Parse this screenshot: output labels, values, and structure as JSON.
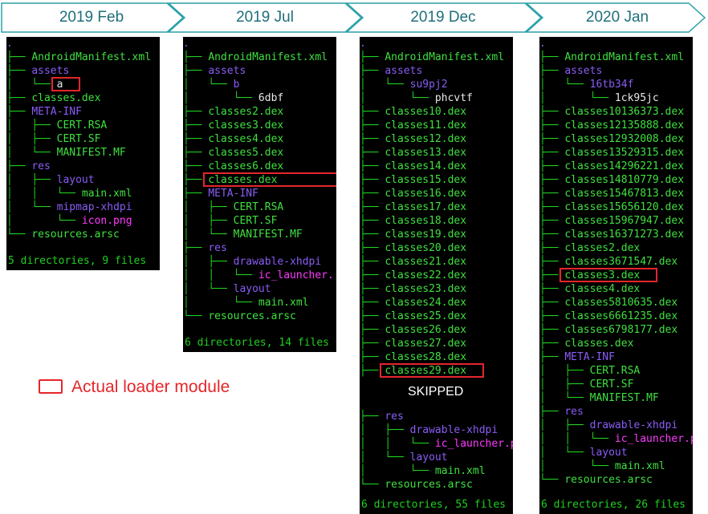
{
  "timeline": [
    "2019 Feb",
    "2019 Jul",
    "2019 Dec",
    "2020 Jan"
  ],
  "legend": {
    "label": "Actual loader module",
    "color": "#e4262b"
  },
  "skipped_label": "SKIPPED",
  "colors": {
    "dir": "#8a5cf5",
    "file": "#3fe03f",
    "tree": "#1fd11f",
    "image": "#ff3aff",
    "timeline": "#1f6f7a"
  },
  "panels": [
    {
      "summary": "5 directories, 9 files",
      "highlight_index": 3,
      "lines": [
        {
          "prefix": "",
          "name": ".",
          "kind": "dir"
        },
        {
          "prefix": "├── ",
          "name": "AndroidManifest.xml",
          "kind": "file"
        },
        {
          "prefix": "├── ",
          "name": "assets",
          "kind": "dir"
        },
        {
          "prefix": "│   └── ",
          "name": "a",
          "kind": "white"
        },
        {
          "prefix": "├── ",
          "name": "classes.dex",
          "kind": "file"
        },
        {
          "prefix": "├── ",
          "name": "META-INF",
          "kind": "dir"
        },
        {
          "prefix": "│   ├── ",
          "name": "CERT.RSA",
          "kind": "file"
        },
        {
          "prefix": "│   ├── ",
          "name": "CERT.SF",
          "kind": "file"
        },
        {
          "prefix": "│   └── ",
          "name": "MANIFEST.MF",
          "kind": "file"
        },
        {
          "prefix": "├── ",
          "name": "res",
          "kind": "dir"
        },
        {
          "prefix": "│   ├── ",
          "name": "layout",
          "kind": "dir"
        },
        {
          "prefix": "│   │   └── ",
          "name": "main.xml",
          "kind": "file"
        },
        {
          "prefix": "│   └── ",
          "name": "mipmap-xhdpi",
          "kind": "dir"
        },
        {
          "prefix": "│       └── ",
          "name": "icon.png",
          "kind": "image"
        },
        {
          "prefix": "└── ",
          "name": "resources.arsc",
          "kind": "file"
        }
      ]
    },
    {
      "summary": "6 directories, 14 files",
      "highlight_index": 10,
      "lines": [
        {
          "prefix": "",
          "name": ".",
          "kind": "dir"
        },
        {
          "prefix": "├── ",
          "name": "AndroidManifest.xml",
          "kind": "file"
        },
        {
          "prefix": "├── ",
          "name": "assets",
          "kind": "dir"
        },
        {
          "prefix": "│   └── ",
          "name": "b",
          "kind": "dir"
        },
        {
          "prefix": "│       └── ",
          "name": "6dbf",
          "kind": "white"
        },
        {
          "prefix": "├── ",
          "name": "classes2.dex",
          "kind": "file"
        },
        {
          "prefix": "├── ",
          "name": "classes3.dex",
          "kind": "file"
        },
        {
          "prefix": "├── ",
          "name": "classes4.dex",
          "kind": "file"
        },
        {
          "prefix": "├── ",
          "name": "classes5.dex",
          "kind": "file"
        },
        {
          "prefix": "├── ",
          "name": "classes6.dex",
          "kind": "file"
        },
        {
          "prefix": "├── ",
          "name": "classes.dex",
          "kind": "file"
        },
        {
          "prefix": "├── ",
          "name": "META-INF",
          "kind": "dir"
        },
        {
          "prefix": "│   ├── ",
          "name": "CERT.RSA",
          "kind": "file"
        },
        {
          "prefix": "│   ├── ",
          "name": "CERT.SF",
          "kind": "file"
        },
        {
          "prefix": "│   └── ",
          "name": "MANIFEST.MF",
          "kind": "file"
        },
        {
          "prefix": "├── ",
          "name": "res",
          "kind": "dir"
        },
        {
          "prefix": "│   ├── ",
          "name": "drawable-xhdpi",
          "kind": "dir"
        },
        {
          "prefix": "│   │   └── ",
          "name": "ic_launcher.",
          "kind": "image"
        },
        {
          "prefix": "│   └── ",
          "name": "layout",
          "kind": "dir"
        },
        {
          "prefix": "│       └── ",
          "name": "main.xml",
          "kind": "file"
        },
        {
          "prefix": "└── ",
          "name": "resources.arsc",
          "kind": "file"
        }
      ]
    },
    {
      "summary": "6 directories, 55 files",
      "highlight_index": 24,
      "skipped_after": 24,
      "lines": [
        {
          "prefix": "",
          "name": ".",
          "kind": "dir"
        },
        {
          "prefix": "├── ",
          "name": "AndroidManifest.xml",
          "kind": "file"
        },
        {
          "prefix": "├── ",
          "name": "assets",
          "kind": "dir"
        },
        {
          "prefix": "│   └── ",
          "name": "su9pj2",
          "kind": "dir"
        },
        {
          "prefix": "│       └── ",
          "name": "phcvtf",
          "kind": "white"
        },
        {
          "prefix": "├── ",
          "name": "classes10.dex",
          "kind": "file"
        },
        {
          "prefix": "├── ",
          "name": "classes11.dex",
          "kind": "file"
        },
        {
          "prefix": "├── ",
          "name": "classes12.dex",
          "kind": "file"
        },
        {
          "prefix": "├── ",
          "name": "classes13.dex",
          "kind": "file"
        },
        {
          "prefix": "├── ",
          "name": "classes14.dex",
          "kind": "file"
        },
        {
          "prefix": "├── ",
          "name": "classes15.dex",
          "kind": "file"
        },
        {
          "prefix": "├── ",
          "name": "classes16.dex",
          "kind": "file"
        },
        {
          "prefix": "├── ",
          "name": "classes17.dex",
          "kind": "file"
        },
        {
          "prefix": "├── ",
          "name": "classes18.dex",
          "kind": "file"
        },
        {
          "prefix": "├── ",
          "name": "classes19.dex",
          "kind": "file"
        },
        {
          "prefix": "├── ",
          "name": "classes20.dex",
          "kind": "file"
        },
        {
          "prefix": "├── ",
          "name": "classes21.dex",
          "kind": "file"
        },
        {
          "prefix": "├── ",
          "name": "classes22.dex",
          "kind": "file"
        },
        {
          "prefix": "├── ",
          "name": "classes23.dex",
          "kind": "file"
        },
        {
          "prefix": "├── ",
          "name": "classes24.dex",
          "kind": "file"
        },
        {
          "prefix": "├── ",
          "name": "classes25.dex",
          "kind": "file"
        },
        {
          "prefix": "├── ",
          "name": "classes26.dex",
          "kind": "file"
        },
        {
          "prefix": "├── ",
          "name": "classes27.dex",
          "kind": "file"
        },
        {
          "prefix": "├── ",
          "name": "classes28.dex",
          "kind": "file"
        },
        {
          "prefix": "├── ",
          "name": "classes29.dex",
          "kind": "file"
        },
        {
          "prefix": "├── ",
          "name": "res",
          "kind": "dir"
        },
        {
          "prefix": "│   ├── ",
          "name": "drawable-xhdpi",
          "kind": "dir"
        },
        {
          "prefix": "│   │   └── ",
          "name": "ic_launcher.p",
          "kind": "image"
        },
        {
          "prefix": "│   └── ",
          "name": "layout",
          "kind": "dir"
        },
        {
          "prefix": "│       └── ",
          "name": "main.xml",
          "kind": "file"
        },
        {
          "prefix": "└── ",
          "name": "resources.arsc",
          "kind": "file"
        }
      ]
    },
    {
      "summary": "6 directories, 26 files",
      "highlight_index": 17,
      "lines": [
        {
          "prefix": "",
          "name": ".",
          "kind": "dir"
        },
        {
          "prefix": "├── ",
          "name": "AndroidManifest.xml",
          "kind": "file"
        },
        {
          "prefix": "├── ",
          "name": "assets",
          "kind": "dir"
        },
        {
          "prefix": "│   └── ",
          "name": "16tb34f",
          "kind": "dir"
        },
        {
          "prefix": "│       └── ",
          "name": "1ck95jc",
          "kind": "white"
        },
        {
          "prefix": "├── ",
          "name": "classes10136373.dex",
          "kind": "file"
        },
        {
          "prefix": "├── ",
          "name": "classes12135888.dex",
          "kind": "file"
        },
        {
          "prefix": "├── ",
          "name": "classes12932008.dex",
          "kind": "file"
        },
        {
          "prefix": "├── ",
          "name": "classes13529315.dex",
          "kind": "file"
        },
        {
          "prefix": "├── ",
          "name": "classes14296221.dex",
          "kind": "file"
        },
        {
          "prefix": "├── ",
          "name": "classes14810779.dex",
          "kind": "file"
        },
        {
          "prefix": "├── ",
          "name": "classes15467813.dex",
          "kind": "file"
        },
        {
          "prefix": "├── ",
          "name": "classes15656120.dex",
          "kind": "file"
        },
        {
          "prefix": "├── ",
          "name": "classes15967947.dex",
          "kind": "file"
        },
        {
          "prefix": "├── ",
          "name": "classes16371273.dex",
          "kind": "file"
        },
        {
          "prefix": "├── ",
          "name": "classes2.dex",
          "kind": "file"
        },
        {
          "prefix": "├── ",
          "name": "classes3671547.dex",
          "kind": "file"
        },
        {
          "prefix": "├── ",
          "name": "classes3.dex",
          "kind": "file"
        },
        {
          "prefix": "├── ",
          "name": "classes4.dex",
          "kind": "file"
        },
        {
          "prefix": "├── ",
          "name": "classes5810635.dex",
          "kind": "file"
        },
        {
          "prefix": "├── ",
          "name": "classes6661235.dex",
          "kind": "file"
        },
        {
          "prefix": "├── ",
          "name": "classes6798177.dex",
          "kind": "file"
        },
        {
          "prefix": "├── ",
          "name": "classes.dex",
          "kind": "file"
        },
        {
          "prefix": "├── ",
          "name": "META-INF",
          "kind": "dir"
        },
        {
          "prefix": "│   ├── ",
          "name": "CERT.RSA",
          "kind": "file"
        },
        {
          "prefix": "│   ├── ",
          "name": "CERT.SF",
          "kind": "file"
        },
        {
          "prefix": "│   └── ",
          "name": "MANIFEST.MF",
          "kind": "file"
        },
        {
          "prefix": "├── ",
          "name": "res",
          "kind": "dir"
        },
        {
          "prefix": "│   ├── ",
          "name": "drawable-xhdpi",
          "kind": "dir"
        },
        {
          "prefix": "│   │   └── ",
          "name": "ic_launcher.p",
          "kind": "image"
        },
        {
          "prefix": "│   └── ",
          "name": "layout",
          "kind": "dir"
        },
        {
          "prefix": "│       └── ",
          "name": "main.xml",
          "kind": "file"
        },
        {
          "prefix": "└── ",
          "name": "resources.arsc",
          "kind": "file"
        }
      ]
    }
  ]
}
